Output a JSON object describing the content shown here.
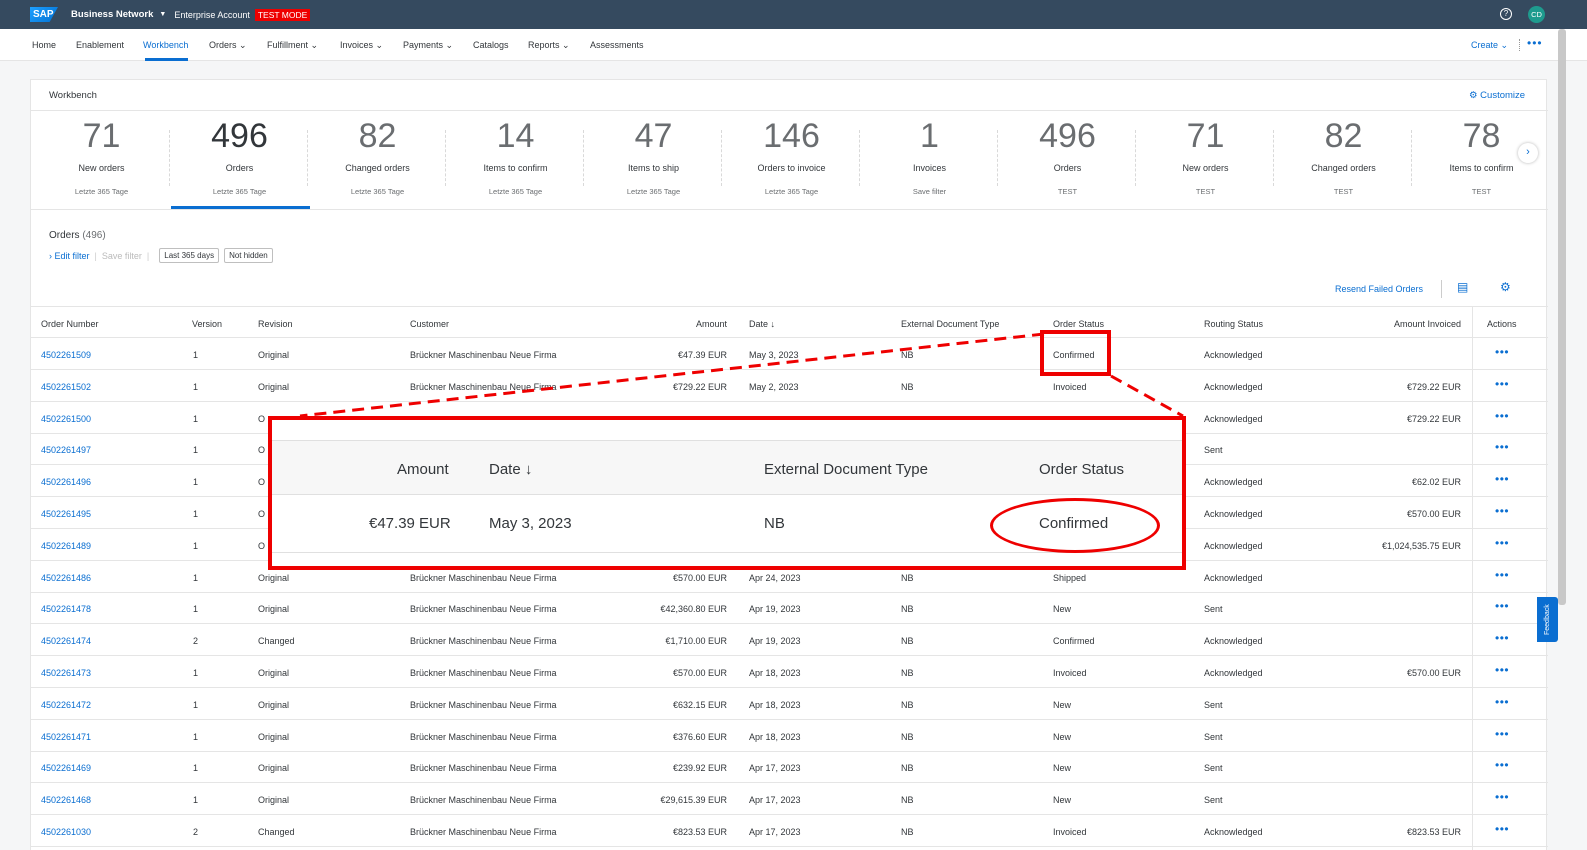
{
  "shell": {
    "logo": "SAP",
    "network": "Business Network",
    "account": "Enterprise Account",
    "test_mode": "TEST MODE",
    "help": "?",
    "avatar": "CD"
  },
  "nav": {
    "items": [
      "Home",
      "Enablement",
      "Workbench",
      "Orders",
      "Fulfillment",
      "Invoices",
      "Payments",
      "Catalogs",
      "Reports",
      "Assessments"
    ],
    "active": "Workbench",
    "create": "Create"
  },
  "workbench": {
    "title": "Workbench",
    "customize": "Customize",
    "tiles": [
      {
        "count": "71",
        "label": "New orders",
        "sub": "Letzte 365 Tage"
      },
      {
        "count": "496",
        "label": "Orders",
        "sub": "Letzte 365 Tage"
      },
      {
        "count": "82",
        "label": "Changed orders",
        "sub": "Letzte 365 Tage"
      },
      {
        "count": "14",
        "label": "Items to confirm",
        "sub": "Letzte 365 Tage"
      },
      {
        "count": "47",
        "label": "Items to ship",
        "sub": "Letzte 365 Tage"
      },
      {
        "count": "146",
        "label": "Orders to invoice",
        "sub": "Letzte 365 Tage"
      },
      {
        "count": "1",
        "label": "Invoices",
        "sub": "Save filter"
      },
      {
        "count": "496",
        "label": "Orders",
        "sub": "TEST"
      },
      {
        "count": "71",
        "label": "New orders",
        "sub": "TEST"
      },
      {
        "count": "82",
        "label": "Changed orders",
        "sub": "TEST"
      },
      {
        "count": "78",
        "label": "Items to confirm",
        "sub": "TEST"
      }
    ]
  },
  "orders": {
    "title": "Orders",
    "count": "(496)",
    "edit_filter": "Edit filter",
    "save_filter": "Save filter",
    "chips": [
      "Last 365 days",
      "Not hidden"
    ],
    "resend": "Resend Failed Orders",
    "columns": [
      "Order Number",
      "Version",
      "Revision",
      "Customer",
      "Amount",
      "Date",
      "External Document Type",
      "Order Status",
      "Routing Status",
      "Amount Invoiced",
      "Actions"
    ],
    "rows": [
      [
        "4502261509",
        "1",
        "Original",
        "Brückner Maschinenbau Neue Firma",
        "€47.39 EUR",
        "May 3, 2023",
        "NB",
        "Confirmed",
        "Acknowledged",
        ""
      ],
      [
        "4502261502",
        "1",
        "Original",
        "Brückner Maschinenbau Neue Firma",
        "€729.22 EUR",
        "May 2, 2023",
        "NB",
        "Invoiced",
        "Acknowledged",
        "€729.22 EUR"
      ],
      [
        "4502261500",
        "1",
        "O",
        "",
        "",
        "",
        "",
        "",
        "Acknowledged",
        "€729.22 EUR"
      ],
      [
        "4502261497",
        "1",
        "O",
        "",
        "",
        "",
        "",
        "",
        "Sent",
        ""
      ],
      [
        "4502261496",
        "1",
        "O",
        "",
        "",
        "",
        "",
        "",
        "Acknowledged",
        "€62.02 EUR"
      ],
      [
        "4502261495",
        "1",
        "O",
        "",
        "",
        "",
        "",
        "",
        "Acknowledged",
        "€570.00 EUR"
      ],
      [
        "4502261489",
        "1",
        "O",
        "",
        "",
        "",
        "",
        "",
        "Acknowledged",
        "€1,024,535.75 EUR"
      ],
      [
        "4502261486",
        "1",
        "Original",
        "Brückner Maschinenbau Neue Firma",
        "€570.00 EUR",
        "Apr 24, 2023",
        "NB",
        "Shipped",
        "Acknowledged",
        ""
      ],
      [
        "4502261478",
        "1",
        "Original",
        "Brückner Maschinenbau Neue Firma",
        "€42,360.80 EUR",
        "Apr 19, 2023",
        "NB",
        "New",
        "Sent",
        ""
      ],
      [
        "4502261474",
        "2",
        "Changed",
        "Brückner Maschinenbau Neue Firma",
        "€1,710.00 EUR",
        "Apr 19, 2023",
        "NB",
        "Confirmed",
        "Acknowledged",
        ""
      ],
      [
        "4502261473",
        "1",
        "Original",
        "Brückner Maschinenbau Neue Firma",
        "€570.00 EUR",
        "Apr 18, 2023",
        "NB",
        "Invoiced",
        "Acknowledged",
        "€570.00 EUR"
      ],
      [
        "4502261472",
        "1",
        "Original",
        "Brückner Maschinenbau Neue Firma",
        "€632.15 EUR",
        "Apr 18, 2023",
        "NB",
        "New",
        "Sent",
        ""
      ],
      [
        "4502261471",
        "1",
        "Original",
        "Brückner Maschinenbau Neue Firma",
        "€376.60 EUR",
        "Apr 18, 2023",
        "NB",
        "New",
        "Sent",
        ""
      ],
      [
        "4502261469",
        "1",
        "Original",
        "Brückner Maschinenbau Neue Firma",
        "€239.92 EUR",
        "Apr 17, 2023",
        "NB",
        "New",
        "Sent",
        ""
      ],
      [
        "4502261468",
        "1",
        "Original",
        "Brückner Maschinenbau Neue Firma",
        "€29,615.39 EUR",
        "Apr 17, 2023",
        "NB",
        "New",
        "Sent",
        ""
      ],
      [
        "4502261030",
        "2",
        "Changed",
        "Brückner Maschinenbau Neue Firma",
        "€823.53 EUR",
        "Apr 17, 2023",
        "NB",
        "Invoiced",
        "Acknowledged",
        "€823.53 EUR"
      ]
    ]
  },
  "zoom": {
    "headers": [
      "Amount",
      "Date",
      "External Document Type",
      "Order Status"
    ],
    "values": [
      "€47.39 EUR",
      "May 3, 2023",
      "NB",
      "Confirmed"
    ]
  },
  "feedback": "Feedback",
  "colors": {
    "shell": "#354a5f",
    "link": "#0a6ed1",
    "highlight": "#e00000",
    "test_badge": "#e00000"
  }
}
